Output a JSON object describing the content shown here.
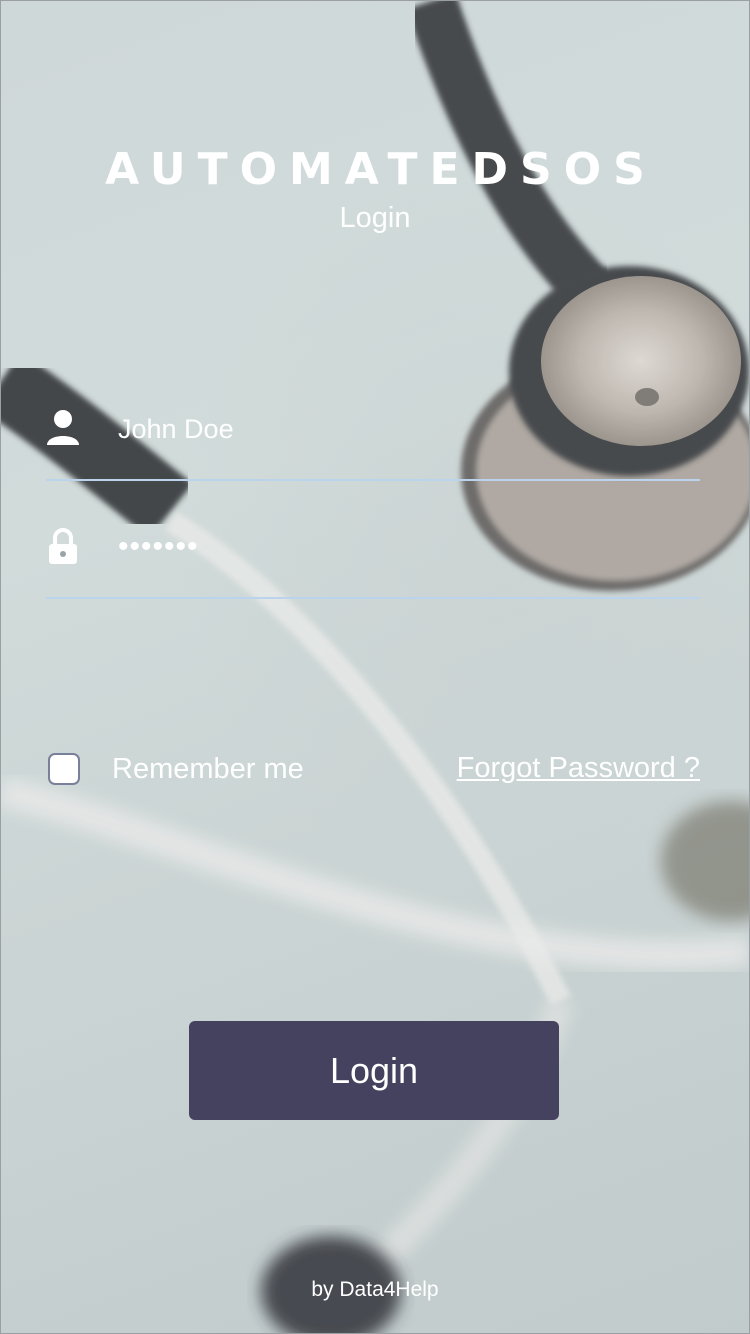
{
  "app": {
    "brand": "AUTOMATEDSOS",
    "subtitle": "Login"
  },
  "form": {
    "username_value": "John Doe",
    "password_value": "•••••••",
    "remember_label": "Remember me",
    "remember_checked": false,
    "forgot_label": "Forgot Password ?",
    "login_label": "Login"
  },
  "footer": {
    "text": "by Data4Help"
  },
  "icons": {
    "username": "user-icon",
    "password": "lock-icon"
  },
  "colors": {
    "button": "#45425f",
    "underline": "#bcd3ee",
    "text": "#ffffff"
  }
}
